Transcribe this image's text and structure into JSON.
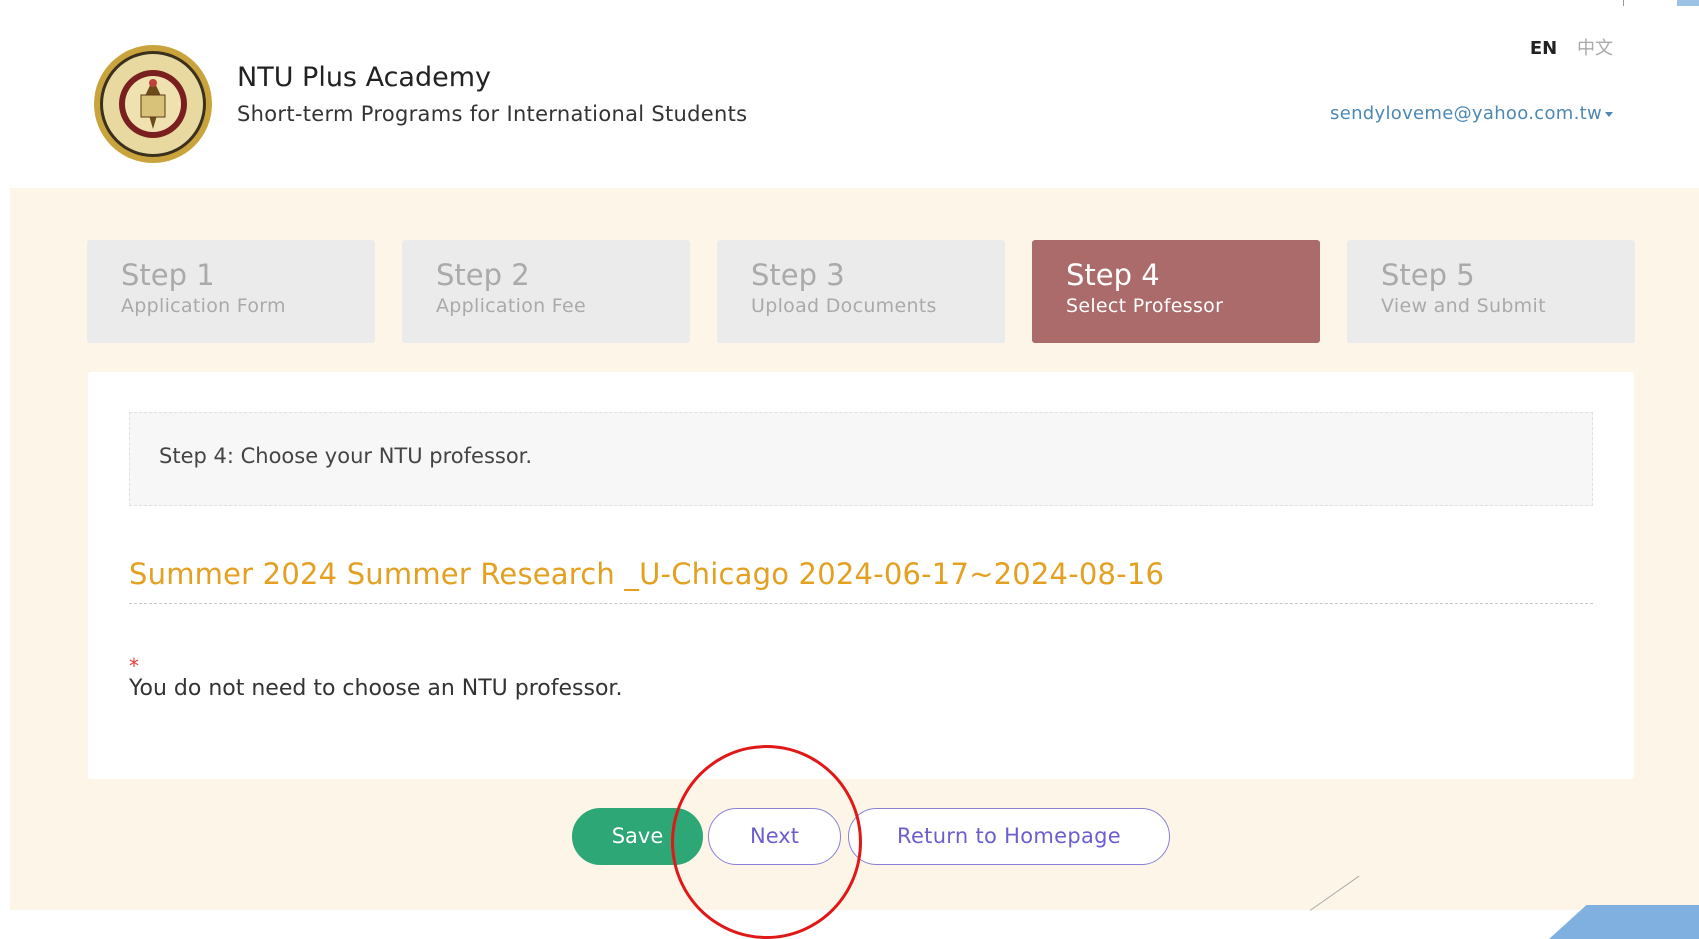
{
  "header": {
    "title": "NTU Plus Academy",
    "subtitle": "Short-term Programs for International Students",
    "lang_en": "EN",
    "lang_zh": "中文",
    "user_email": "sendyloveme@yahoo.com.tw"
  },
  "steps": [
    {
      "num": "Step 1",
      "label": "Application Form"
    },
    {
      "num": "Step 2",
      "label": "Application Fee"
    },
    {
      "num": "Step 3",
      "label": "Upload Documents"
    },
    {
      "num": "Step 4",
      "label": "Select Professor"
    },
    {
      "num": "Step 5",
      "label": "View and Submit"
    }
  ],
  "active_step": 4,
  "main": {
    "notice": "Step 4: Choose your NTU professor.",
    "program_title": "Summer 2024 Summer Research _U-Chicago 2024-06-17~2024-08-16",
    "required_mark": "*",
    "message": "You do not need to choose an NTU professor."
  },
  "buttons": {
    "save": "Save",
    "next": "Next",
    "home": "Return to Homepage"
  },
  "colors": {
    "active_step": "#ac6b6b",
    "program_title": "#e3a021",
    "save_button": "#2da776",
    "outline_button": "#6b5fd0",
    "highlight_circle": "#e01818"
  }
}
